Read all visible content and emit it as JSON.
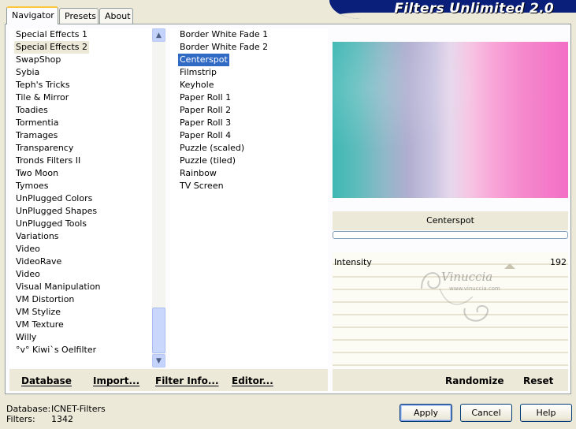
{
  "app": {
    "title": "Filters Unlimited 2.0"
  },
  "tabs": [
    {
      "label": "Navigator",
      "active": true
    },
    {
      "label": "Presets",
      "active": false
    },
    {
      "label": "About",
      "active": false
    }
  ],
  "categories": {
    "items": [
      "Special Effects 1",
      "Special Effects 2",
      "SwapShop",
      "Sybia",
      "Teph's Tricks",
      "Tile & Mirror",
      "Toadies",
      "Tormentia",
      "Tramages",
      "Transparency",
      "Tronds Filters II",
      "Two Moon",
      "Tymoes",
      "UnPlugged Colors",
      "UnPlugged Shapes",
      "UnPlugged Tools",
      "Variations",
      "Video",
      "VideoRave",
      "Video",
      "Visual Manipulation",
      "VM Distortion",
      "VM Stylize",
      "VM Texture",
      "Willy",
      "°v° Kiwi`s Oelfilter"
    ],
    "selected_index": 1
  },
  "filters": {
    "items": [
      "Border White Fade 1",
      "Border White Fade 2",
      "Centerspot",
      "Filmstrip",
      "Keyhole",
      "Paper Roll 1",
      "Paper Roll 2",
      "Paper Roll 3",
      "Paper Roll 4",
      "Puzzle (scaled)",
      "Puzzle (tiled)",
      "Rainbow",
      "TV Screen"
    ],
    "selected_index": 2
  },
  "preview": {
    "filter_name": "Centerspot",
    "params": [
      {
        "label": "Intensity",
        "value": "192"
      }
    ]
  },
  "watermark": {
    "text": "Vinuccia",
    "subtext": "www.vinuccia.com"
  },
  "toolbar": {
    "database": "Database",
    "import": "Import...",
    "filter_info": "Filter Info...",
    "editor": "Editor...",
    "randomize": "Randomize",
    "reset": "Reset"
  },
  "info": {
    "database_label": "Database:",
    "database_value": "ICNET-Filters",
    "filters_label": "Filters:",
    "filters_value": "1342"
  },
  "buttons": {
    "apply": "Apply",
    "cancel": "Cancel",
    "help": "Help"
  },
  "colors": {
    "banner": "#0a1f7a",
    "selection": "#316ac5",
    "dialog_bg": "#ece9d8"
  }
}
